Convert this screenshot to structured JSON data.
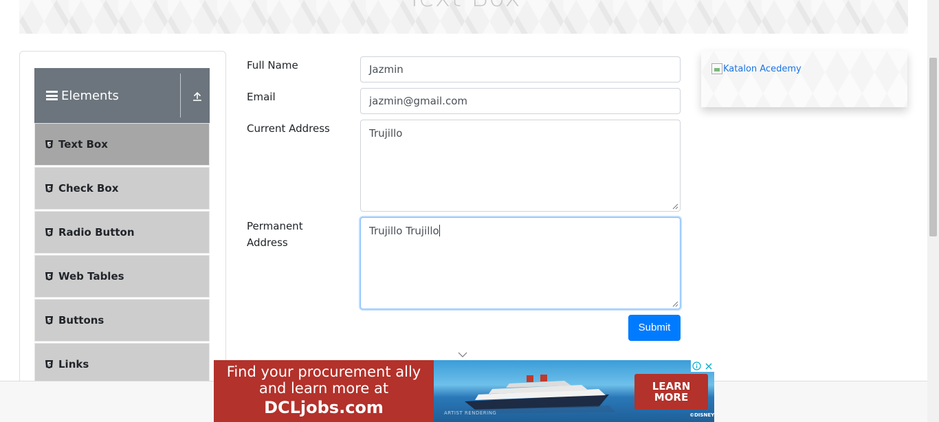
{
  "header": {
    "title": "Text Box"
  },
  "sidebar": {
    "group_title": "Elements",
    "items": [
      {
        "label": "Text Box",
        "active": true
      },
      {
        "label": "Check Box",
        "active": false
      },
      {
        "label": "Radio Button",
        "active": false
      },
      {
        "label": "Web Tables",
        "active": false
      },
      {
        "label": "Buttons",
        "active": false
      },
      {
        "label": "Links",
        "active": false
      }
    ]
  },
  "form": {
    "full_name": {
      "label": "Full Name",
      "value": "Jazmin"
    },
    "email": {
      "label": "Email",
      "value": "jazmin@gmail.com"
    },
    "current_address": {
      "label": "Current Address",
      "value": "Trujillo"
    },
    "permanent_address": {
      "label_line1": "Permanent",
      "label_line2": "Address",
      "value": "Trujillo Trujillo"
    },
    "submit_label": "Submit"
  },
  "side_ad": {
    "alt_text": "Katalon Acedemy"
  },
  "bottom_ad": {
    "line1": "Find your procurement ally",
    "line2": "and learn more at",
    "line3": "DCLjobs.com",
    "artist_note": "ARTIST RENDERING",
    "cta_line1": "LEARN",
    "cta_line2": "MORE",
    "brand": "©DISNEY"
  },
  "colors": {
    "primary": "#007bff",
    "sidebar_header": "#6c757d",
    "menu_item": "#cdcdcd",
    "menu_item_active": "#a6a6a6",
    "ad_red": "#b3322b"
  },
  "icons": {
    "menu": "hamburger-icon",
    "collapse": "arrow-up-icon",
    "item": "html5-icon",
    "scroll_hint": "chevron-down-icon"
  }
}
